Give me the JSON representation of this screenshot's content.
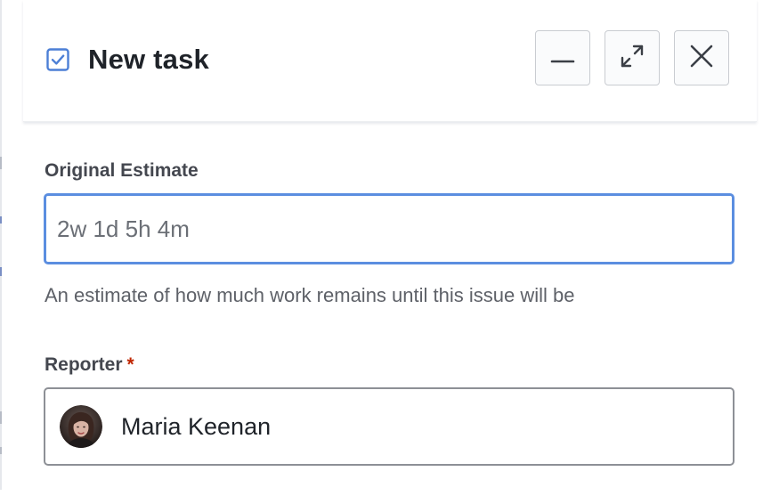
{
  "dialog": {
    "title": "New task",
    "actions": {
      "minimize_icon": "minimize-icon",
      "expand_icon": "expand-icon",
      "close_icon": "close-icon"
    }
  },
  "fields": {
    "original_estimate": {
      "label": "Original Estimate",
      "placeholder": "2w 1d 5h 4m",
      "value": "",
      "help": "An estimate of how much work remains until this issue will be"
    },
    "reporter": {
      "label": "Reporter",
      "required_marker": "*",
      "selected_user": "Maria Keenan"
    }
  },
  "colors": {
    "accent": "#5b8ee0",
    "task_icon": "#4c7fd6",
    "required": "#bf2600"
  }
}
